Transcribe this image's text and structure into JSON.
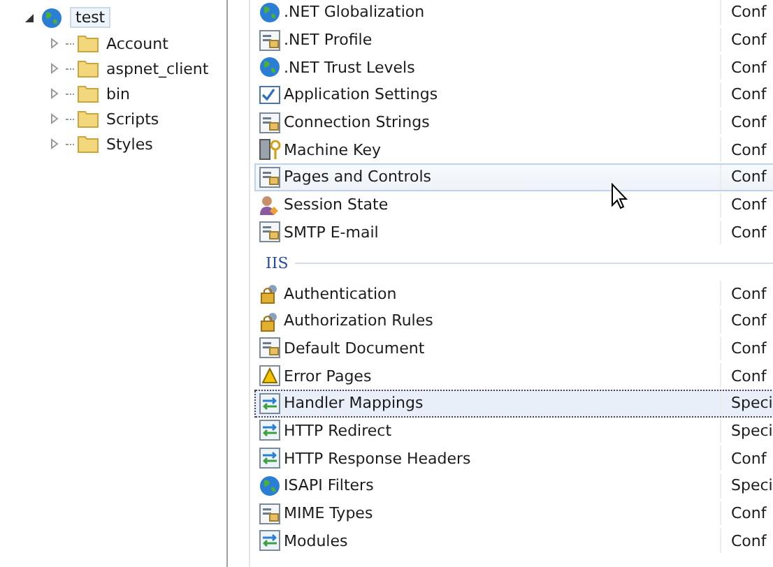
{
  "tree": {
    "site": {
      "label": "test",
      "expanded": true,
      "selected": true,
      "children": [
        {
          "label": "Account",
          "expanded": false
        },
        {
          "label": "aspnet_client",
          "expanded": false
        },
        {
          "label": "bin",
          "expanded": false
        },
        {
          "label": "Scripts",
          "expanded": false
        },
        {
          "label": "Styles",
          "expanded": false
        }
      ]
    }
  },
  "features": [
    {
      "kind": "feature",
      "name": ".NET Globalization",
      "column_2": "Conf",
      "selected": false,
      "hovered": false
    },
    {
      "kind": "feature",
      "name": ".NET Profile",
      "column_2": "Conf",
      "selected": false,
      "hovered": false
    },
    {
      "kind": "feature",
      "name": ".NET Trust Levels",
      "column_2": "Conf",
      "selected": false,
      "hovered": false
    },
    {
      "kind": "feature",
      "name": "Application Settings",
      "column_2": "Conf",
      "selected": false,
      "hovered": false
    },
    {
      "kind": "feature",
      "name": "Connection Strings",
      "column_2": "Conf",
      "selected": false,
      "hovered": false
    },
    {
      "kind": "feature",
      "name": "Machine Key",
      "column_2": "Conf",
      "selected": false,
      "hovered": false
    },
    {
      "kind": "feature",
      "name": "Pages and Controls",
      "column_2": "Conf",
      "selected": false,
      "hovered": true
    },
    {
      "kind": "feature",
      "name": "Session State",
      "column_2": "Conf",
      "selected": false,
      "hovered": false
    },
    {
      "kind": "feature",
      "name": "SMTP E-mail",
      "column_2": "Conf",
      "selected": false,
      "hovered": false
    },
    {
      "kind": "group",
      "name": "IIS"
    },
    {
      "kind": "feature",
      "name": "Authentication",
      "column_2": "Conf",
      "selected": false,
      "hovered": false
    },
    {
      "kind": "feature",
      "name": "Authorization Rules",
      "column_2": "Conf",
      "selected": false,
      "hovered": false
    },
    {
      "kind": "feature",
      "name": "Default Document",
      "column_2": "Conf",
      "selected": false,
      "hovered": false
    },
    {
      "kind": "feature",
      "name": "Error Pages",
      "column_2": "Conf",
      "selected": false,
      "hovered": false
    },
    {
      "kind": "feature",
      "name": "Handler Mappings",
      "column_2": "Speci",
      "selected": true,
      "hovered": false
    },
    {
      "kind": "feature",
      "name": "HTTP Redirect",
      "column_2": "Speci",
      "selected": false,
      "hovered": false
    },
    {
      "kind": "feature",
      "name": "HTTP Response Headers",
      "column_2": "Conf",
      "selected": false,
      "hovered": false
    },
    {
      "kind": "feature",
      "name": "ISAPI Filters",
      "column_2": "Speci",
      "selected": false,
      "hovered": false
    },
    {
      "kind": "feature",
      "name": "MIME Types",
      "column_2": "Conf",
      "selected": false,
      "hovered": false
    },
    {
      "kind": "feature",
      "name": "Modules",
      "column_2": "Conf",
      "selected": false,
      "hovered": false
    }
  ]
}
